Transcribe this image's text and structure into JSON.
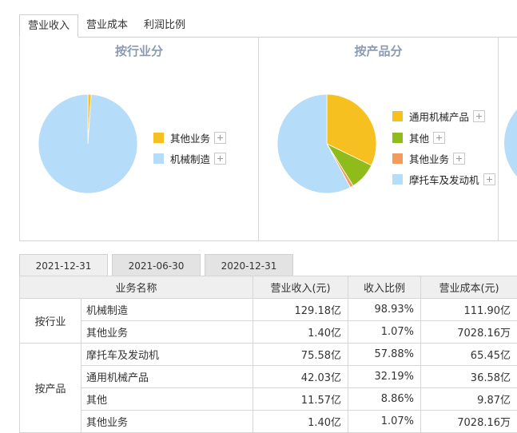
{
  "tabs": [
    "营业收入",
    "营业成本",
    "利润比例"
  ],
  "panels": [
    {
      "title": "按行业分",
      "legend": [
        {
          "label": "其他业务",
          "color": "#f6c120"
        },
        {
          "label": "机械制造",
          "color": "#b5dcf9"
        }
      ]
    },
    {
      "title": "按产品分",
      "legend": [
        {
          "label": "通用机械产品",
          "color": "#f6c120"
        },
        {
          "label": "其他",
          "color": "#90bc1b"
        },
        {
          "label": "其他业务",
          "color": "#f49b5c"
        },
        {
          "label": "摩托车及发动机",
          "color": "#b5dcf9"
        }
      ]
    }
  ],
  "date_tabs": [
    "2021-12-31",
    "2021-06-30",
    "2020-12-31"
  ],
  "table": {
    "headers": [
      "业务名称",
      "营业收入(元)",
      "收入比例",
      "营业成本(元)"
    ],
    "groups": [
      {
        "name": "按行业",
        "rows": [
          [
            "机械制造",
            "129.18亿",
            "98.93%",
            "111.90亿"
          ],
          [
            "其他业务",
            "1.40亿",
            "1.07%",
            "7028.16万"
          ]
        ]
      },
      {
        "name": "按产品",
        "rows": [
          [
            "摩托车及发动机",
            "75.58亿",
            "57.88%",
            "65.45亿"
          ],
          [
            "通用机械产品",
            "42.03亿",
            "32.19%",
            "36.58亿"
          ],
          [
            "其他",
            "11.57亿",
            "8.86%",
            "9.87亿"
          ],
          [
            "其他业务",
            "1.40亿",
            "1.07%",
            "7028.16万"
          ]
        ]
      }
    ]
  },
  "chart_data": [
    {
      "type": "pie",
      "title": "按行业分",
      "labels": [
        "其他业务",
        "机械制造"
      ],
      "values": [
        1.07,
        98.93
      ],
      "colors": [
        "#f6c120",
        "#b5dcf9"
      ]
    },
    {
      "type": "pie",
      "title": "按产品分",
      "labels": [
        "通用机械产品",
        "其他",
        "其他业务",
        "摩托车及发动机"
      ],
      "values": [
        32.19,
        8.86,
        1.07,
        57.88
      ],
      "colors": [
        "#f6c120",
        "#90bc1b",
        "#f49b5c",
        "#b5dcf9"
      ]
    }
  ]
}
